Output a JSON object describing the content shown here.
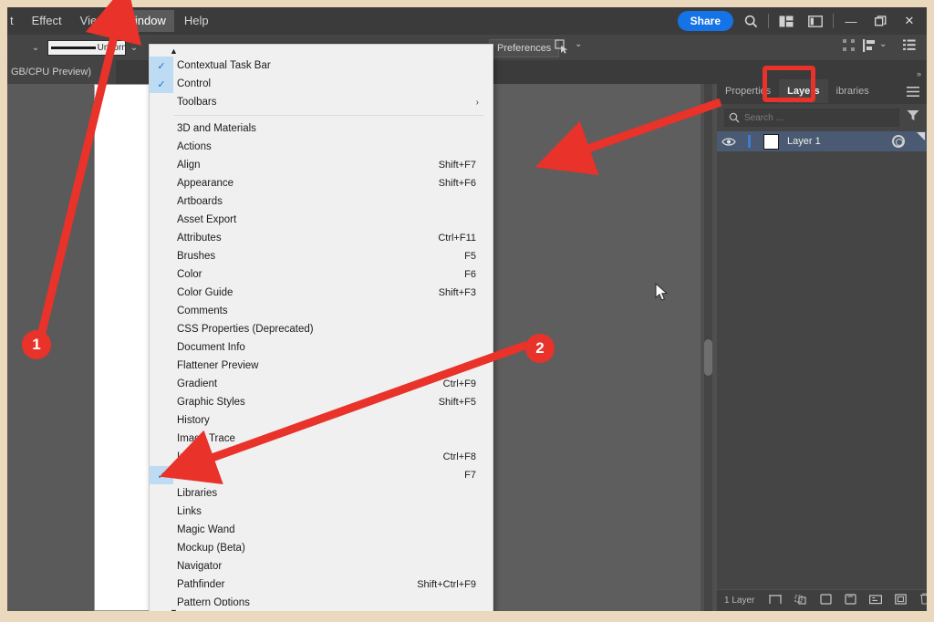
{
  "app": {
    "menubar": {
      "items": [
        {
          "label": "t",
          "active": false
        },
        {
          "label": "Effect",
          "active": false
        },
        {
          "label": "View",
          "active": false
        },
        {
          "label": "Window",
          "active": true
        },
        {
          "label": "Help",
          "active": false
        }
      ],
      "share_label": "Share",
      "icons": {
        "search": "search-icon",
        "arrange": "arrange-documents-icon",
        "workspace": "workspace-switcher-icon",
        "minimize": "minimize-icon",
        "restore": "restore-icon",
        "close": "close-icon"
      },
      "minimize_glyph": "—",
      "restore_glyph": "❐",
      "close_glyph": "✕"
    },
    "controlbar": {
      "stroke_label": "Uniform",
      "preferences_label": "Preferences",
      "chevron_glyph": "⌄"
    },
    "doctab": {
      "title": "GB/CPU Preview)",
      "close_glyph": "✕"
    }
  },
  "dropdown": {
    "name": "Window",
    "scroll_up_glyph": "▲",
    "scroll_down_glyph": "▼",
    "check_glyph": "✓",
    "submenu_glyph": "›",
    "groups": [
      {
        "items": [
          {
            "label": "Contextual Task Bar",
            "shortcut": "",
            "checked": true,
            "submenu": false
          },
          {
            "label": "Control",
            "shortcut": "",
            "checked": true,
            "submenu": false
          },
          {
            "label": "Toolbars",
            "shortcut": "",
            "checked": false,
            "submenu": true
          }
        ]
      },
      {
        "items": [
          {
            "label": "3D and Materials",
            "shortcut": "",
            "checked": false,
            "submenu": false
          },
          {
            "label": "Actions",
            "shortcut": "",
            "checked": false,
            "submenu": false
          },
          {
            "label": "Align",
            "shortcut": "Shift+F7",
            "checked": false,
            "submenu": false
          },
          {
            "label": "Appearance",
            "shortcut": "Shift+F6",
            "checked": false,
            "submenu": false
          },
          {
            "label": "Artboards",
            "shortcut": "",
            "checked": false,
            "submenu": false
          },
          {
            "label": "Asset Export",
            "shortcut": "",
            "checked": false,
            "submenu": false
          },
          {
            "label": "Attributes",
            "shortcut": "Ctrl+F11",
            "checked": false,
            "submenu": false
          },
          {
            "label": "Brushes",
            "shortcut": "F5",
            "checked": false,
            "submenu": false
          },
          {
            "label": "Color",
            "shortcut": "F6",
            "checked": false,
            "submenu": false
          },
          {
            "label": "Color Guide",
            "shortcut": "Shift+F3",
            "checked": false,
            "submenu": false
          },
          {
            "label": "Comments",
            "shortcut": "",
            "checked": false,
            "submenu": false
          },
          {
            "label": "CSS Properties (Deprecated)",
            "shortcut": "",
            "checked": false,
            "submenu": false
          },
          {
            "label": "Document Info",
            "shortcut": "",
            "checked": false,
            "submenu": false
          },
          {
            "label": "Flattener Preview",
            "shortcut": "",
            "checked": false,
            "submenu": false
          },
          {
            "label": "Gradient",
            "shortcut": "Ctrl+F9",
            "checked": false,
            "submenu": false
          },
          {
            "label": "Graphic Styles",
            "shortcut": "Shift+F5",
            "checked": false,
            "submenu": false
          },
          {
            "label": "History",
            "shortcut": "",
            "checked": false,
            "submenu": false
          },
          {
            "label": "Image Trace",
            "shortcut": "",
            "checked": false,
            "submenu": false
          },
          {
            "label": "Info",
            "shortcut": "Ctrl+F8",
            "checked": false,
            "submenu": false
          },
          {
            "label": "Layers",
            "shortcut": "F7",
            "checked": true,
            "submenu": false
          },
          {
            "label": "Libraries",
            "shortcut": "",
            "checked": false,
            "submenu": false
          },
          {
            "label": "Links",
            "shortcut": "",
            "checked": false,
            "submenu": false
          },
          {
            "label": "Magic Wand",
            "shortcut": "",
            "checked": false,
            "submenu": false
          },
          {
            "label": "Mockup (Beta)",
            "shortcut": "",
            "checked": false,
            "submenu": false
          },
          {
            "label": "Navigator",
            "shortcut": "",
            "checked": false,
            "submenu": false
          },
          {
            "label": "Pathfinder",
            "shortcut": "Shift+Ctrl+F9",
            "checked": false,
            "submenu": false
          },
          {
            "label": "Pattern Options",
            "shortcut": "",
            "checked": false,
            "submenu": false
          }
        ]
      }
    ]
  },
  "right_panel": {
    "tabs": [
      {
        "label": "Properties",
        "active": false
      },
      {
        "label": "Layers",
        "active": true
      },
      {
        "label": "ibraries",
        "active": false
      }
    ],
    "panel_menu_glyph": "☰",
    "expand_glyph": "»",
    "search_placeholder": "Search ...",
    "layers": [
      {
        "name": "Layer 1",
        "visible": true,
        "selected": true
      }
    ],
    "footer_count": "1 Layer",
    "footer_icons": [
      "locate-object-icon",
      "make-clipping-mask-icon",
      "create-new-sublayer-icon",
      "create-new-layer-icon",
      "collect-in-new-layer-icon",
      "release-to-layers-icon",
      "delete-layer-icon"
    ]
  },
  "annotations": {
    "badges": [
      {
        "id": "1",
        "label": "1"
      },
      {
        "id": "2",
        "label": "2"
      }
    ],
    "accent_color": "#e8322a"
  }
}
